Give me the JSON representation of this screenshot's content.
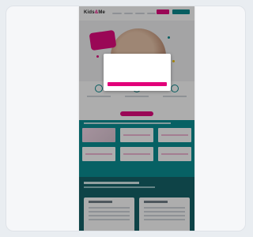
{
  "header": {
    "logo_main": "Kids",
    "logo_accent": "&",
    "logo_tail": "Me"
  },
  "cookie_dialog": {
    "title": "",
    "body": "",
    "accept_label": "",
    "settings_label": ""
  },
  "colors": {
    "brand_magenta": "#e2007a",
    "brand_teal": "#008a8f",
    "dark_teal": "#0b5c63"
  }
}
